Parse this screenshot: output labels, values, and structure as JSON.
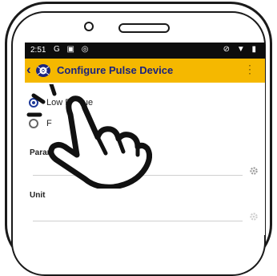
{
  "status_bar": {
    "time": "2:51",
    "left_icons": "G ▣ ◎",
    "right_icons": "⊘ ▼ ▮"
  },
  "app_bar": {
    "back_icon": "chevron-left-icon",
    "logo_icon": "pulse-logo-icon",
    "title": "Configure Pulse Device",
    "menu_icon": "overflow-menu-icon",
    "background_color": "#f5b800",
    "title_color": "#1a237e"
  },
  "form": {
    "options": [
      {
        "label": "Low Freque",
        "selected": true
      },
      {
        "label": "F",
        "selected": false
      }
    ],
    "fields": [
      {
        "label": "Paramete",
        "value": ""
      },
      {
        "label": "Unit",
        "value": ""
      }
    ],
    "settings_icon": "gear-icon"
  },
  "overlay": {
    "icon": "tap-hand-icon"
  }
}
